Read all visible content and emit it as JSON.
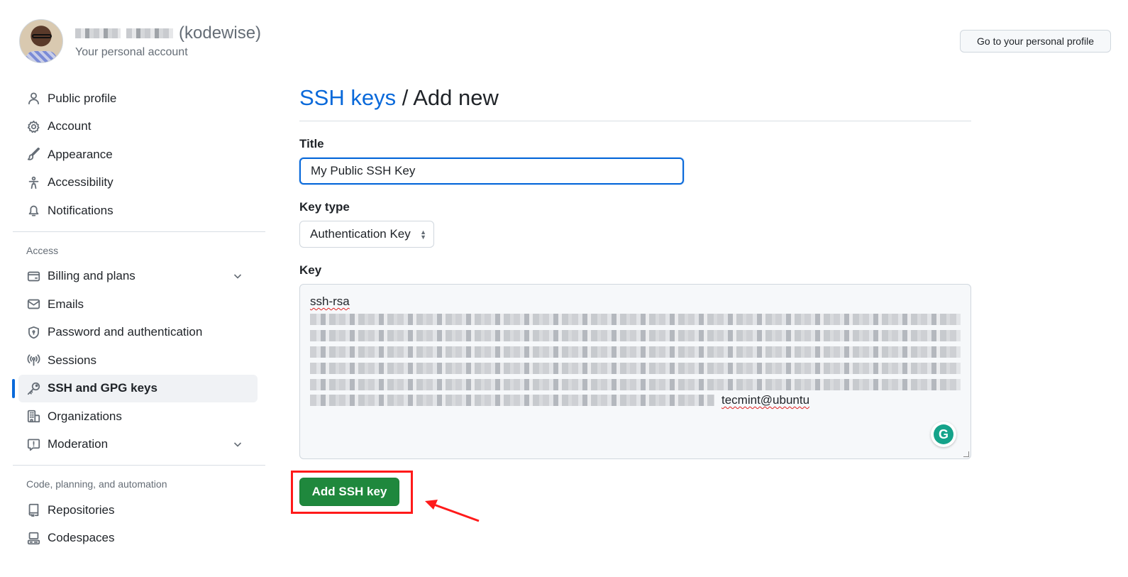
{
  "header": {
    "username": "(kodewise)",
    "subtitle": "Your personal account",
    "profile_button": "Go to your personal profile"
  },
  "sidebar": {
    "items": [
      {
        "label": "Public profile",
        "icon": "person-icon"
      },
      {
        "label": "Account",
        "icon": "gear-icon"
      },
      {
        "label": "Appearance",
        "icon": "paintbrush-icon"
      },
      {
        "label": "Accessibility",
        "icon": "accessibility-icon"
      },
      {
        "label": "Notifications",
        "icon": "bell-icon"
      }
    ],
    "section_access": "Access",
    "access_items": [
      {
        "label": "Billing and plans",
        "icon": "credit-card-icon",
        "expandable": true
      },
      {
        "label": "Emails",
        "icon": "mail-icon"
      },
      {
        "label": "Password and authentication",
        "icon": "shield-lock-icon"
      },
      {
        "label": "Sessions",
        "icon": "broadcast-icon"
      },
      {
        "label": "SSH and GPG keys",
        "icon": "key-icon",
        "active": true
      },
      {
        "label": "Organizations",
        "icon": "organization-icon"
      },
      {
        "label": "Moderation",
        "icon": "report-icon",
        "expandable": true
      }
    ],
    "section_code": "Code, planning, and automation",
    "code_items": [
      {
        "label": "Repositories",
        "icon": "repo-icon"
      },
      {
        "label": "Codespaces",
        "icon": "codespaces-icon"
      }
    ]
  },
  "main": {
    "breadcrumb_link": "SSH keys",
    "breadcrumb_sep": " / ",
    "breadcrumb_current": "Add new",
    "title_label": "Title",
    "title_value": "My Public SSH Key",
    "keytype_label": "Key type",
    "keytype_value": "Authentication Key",
    "key_label": "Key",
    "key_first_line": "ssh-rsa",
    "key_tail": "tecmint@ubuntu",
    "submit_button": "Add SSH key"
  },
  "colors": {
    "accent": "#0969da",
    "primary_button": "#1f883d",
    "annotation": "#ff1a1a"
  }
}
